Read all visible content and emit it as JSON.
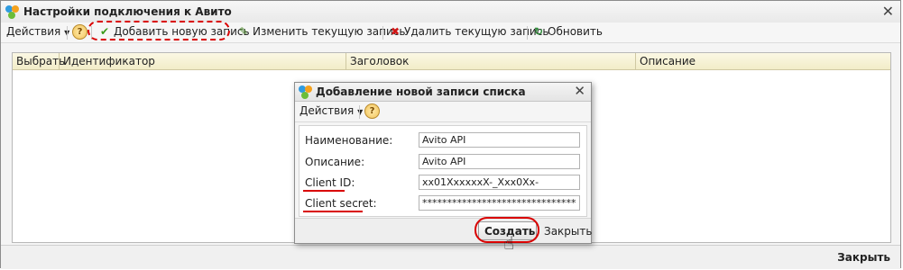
{
  "main_window": {
    "title": "Настройки подключения к Авито",
    "close_glyph": "✕",
    "toolbar": {
      "actions_label": "Действия",
      "help_glyph": "?",
      "add_label": "Добавить новую запись",
      "edit_label": "Изменить текущую запись",
      "delete_label": "Удалить текущую запись",
      "refresh_label": "Обновить",
      "add_icon": "check-icon",
      "edit_icon": "pencil-icon",
      "delete_icon": "red-x-icon",
      "refresh_icon": "refresh-icon"
    },
    "table": {
      "columns": [
        "Выбрать",
        "Идентификатор",
        "Заголовок",
        "Описание"
      ]
    },
    "close_button_label": "Закрыть"
  },
  "dialog": {
    "title": "Добавление новой записи списка",
    "close_glyph": "✕",
    "actions_label": "Действия",
    "help_glyph": "?",
    "fields": [
      {
        "label": "Наименование:",
        "value": "Avito API"
      },
      {
        "label": "Описание:",
        "value": "Avito API"
      },
      {
        "label": "Client ID:",
        "value": "xx01XxxxxxX-_Xxx0Xx-"
      },
      {
        "label": "Client secret:",
        "value": "************************************"
      }
    ],
    "create_label": "Создать",
    "close_label": "Закрыть"
  },
  "colors": {
    "highlight": "#d90000",
    "grid_header": "#f2ecc8"
  }
}
